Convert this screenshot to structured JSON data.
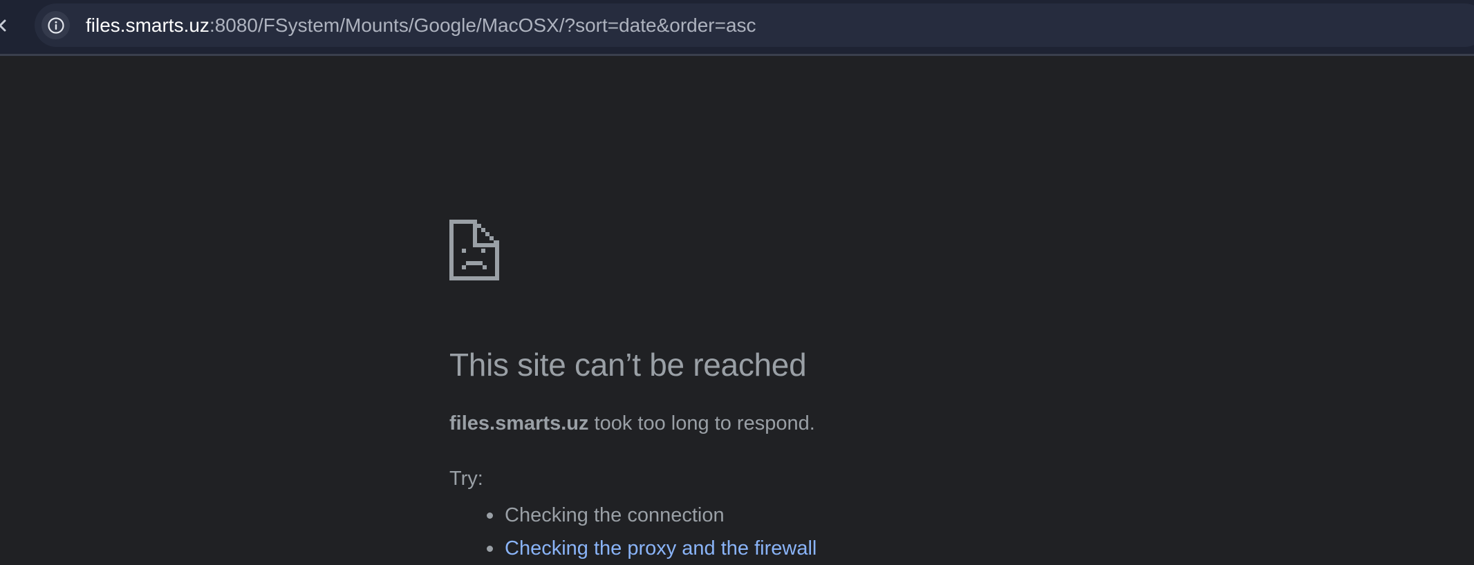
{
  "browser": {
    "url_host": "files.smarts.uz",
    "url_rest": ":8080/FSystem/Mounts/Google/MacOSX/?sort=date&order=asc",
    "toolbar_color": "#1e2333",
    "omnibox_color": "#262c3e"
  },
  "icons": {
    "back": "chevron-left-icon",
    "site_info": "info-icon",
    "error": "sad-document-icon"
  },
  "error_page": {
    "title": "This site can’t be reached",
    "domain": "files.smarts.uz",
    "message": " took too long to respond.",
    "try_label": "Try:",
    "suggestions": [
      {
        "text": "Checking the connection",
        "is_link": false
      },
      {
        "text": "Checking the proxy and the firewall",
        "is_link": true
      }
    ],
    "text_color": "#9aa0a6",
    "link_color": "#8ab4f8",
    "background": "#202124"
  }
}
